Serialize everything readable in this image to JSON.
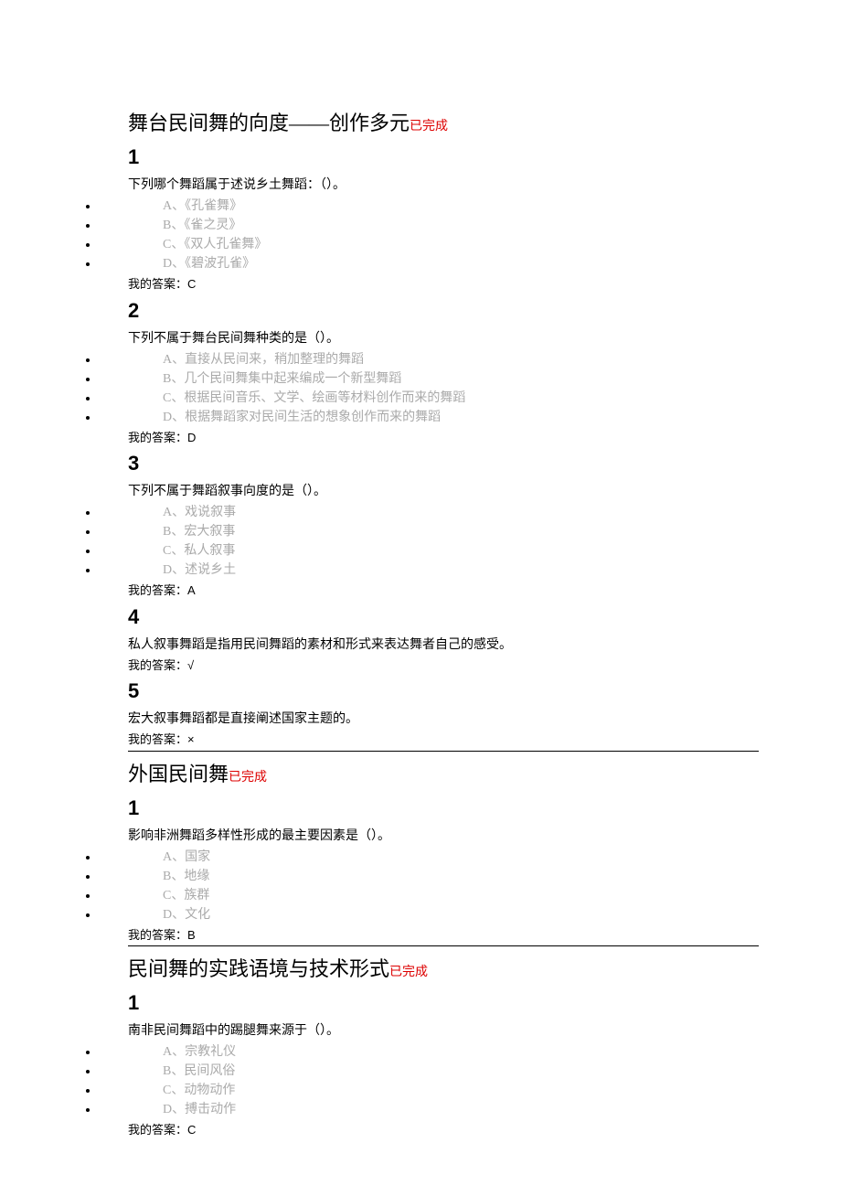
{
  "sections": [
    {
      "title": "舞台民间舞的向度——创作多元",
      "status": "已完成",
      "hr_after": true,
      "questions": [
        {
          "num": "1",
          "text": "下列哪个舞蹈属于述说乡土舞蹈：（）。",
          "options": [
            "A、《孔雀舞》",
            "B、《雀之灵》",
            "C、《双人孔雀舞》",
            "D、《碧波孔雀》"
          ],
          "ans_label": "我的答案：",
          "ans_value": "C"
        },
        {
          "num": "2",
          "text": "下列不属于舞台民间舞种类的是（）。",
          "options": [
            "A、直接从民间来，稍加整理的舞蹈",
            "B、几个民间舞集中起来编成一个新型舞蹈",
            "C、根据民间音乐、文学、绘画等材料创作而来的舞蹈",
            "D、根据舞蹈家对民间生活的想象创作而来的舞蹈"
          ],
          "ans_label": "我的答案：",
          "ans_value": "D"
        },
        {
          "num": "3",
          "text": "下列不属于舞蹈叙事向度的是（）。",
          "options": [
            "A、戏说叙事",
            "B、宏大叙事",
            "C、私人叙事",
            "D、述说乡土"
          ],
          "ans_label": "我的答案：",
          "ans_value": "A"
        },
        {
          "num": "4",
          "text": "私人叙事舞蹈是指用民间舞蹈的素材和形式来表达舞者自己的感受。",
          "options": [],
          "ans_label": "我的答案：",
          "ans_value": "√"
        },
        {
          "num": "5",
          "text": "宏大叙事舞蹈都是直接阐述国家主题的。",
          "options": [],
          "ans_label": "我的答案：",
          "ans_value": "×"
        }
      ]
    },
    {
      "title": "外国民间舞",
      "status": "已完成",
      "hr_after": true,
      "questions": [
        {
          "num": "1",
          "text": "影响非洲舞蹈多样性形成的最主要因素是（）。",
          "options": [
            "A、国家",
            "B、地缘",
            "C、族群",
            "D、文化"
          ],
          "ans_label": "我的答案：",
          "ans_value": "B"
        }
      ]
    },
    {
      "title": "民间舞的实践语境与技术形式",
      "status": "已完成",
      "hr_after": false,
      "questions": [
        {
          "num": "1",
          "text": "南非民间舞蹈中的踢腿舞来源于（）。",
          "options": [
            "A、宗教礼仪",
            "B、民间风俗",
            "C、动物动作",
            "D、搏击动作"
          ],
          "ans_label": "我的答案：",
          "ans_value": "C"
        }
      ]
    }
  ]
}
